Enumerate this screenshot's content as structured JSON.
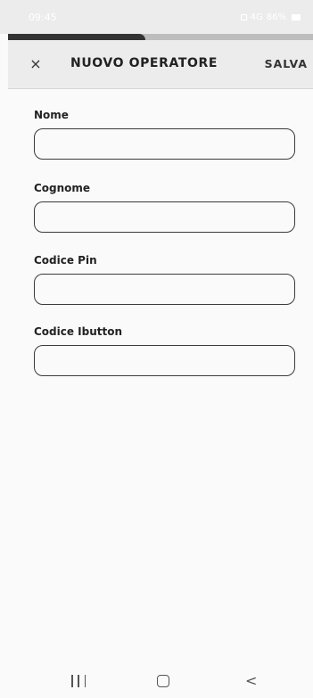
{
  "status_bar": {
    "time": "09:45",
    "network": "4G",
    "battery": "86%"
  },
  "progress": {
    "value": 0.45
  },
  "app_bar": {
    "close_label": "×",
    "title": "NUOVO OPERATORE",
    "save_label": "SALVA"
  },
  "form": {
    "fields": [
      {
        "label": "Nome",
        "value": "",
        "placeholder": ""
      },
      {
        "label": "Cognome",
        "value": "",
        "placeholder": ""
      },
      {
        "label": "Codice Pin",
        "value": "",
        "placeholder": ""
      },
      {
        "label": "Codice Ibutton",
        "value": "",
        "placeholder": ""
      }
    ]
  },
  "nav_bar": {
    "recents_icon": "recents-icon",
    "home_icon": "home-icon",
    "back_icon": "back-icon",
    "back_glyph": "<"
  }
}
